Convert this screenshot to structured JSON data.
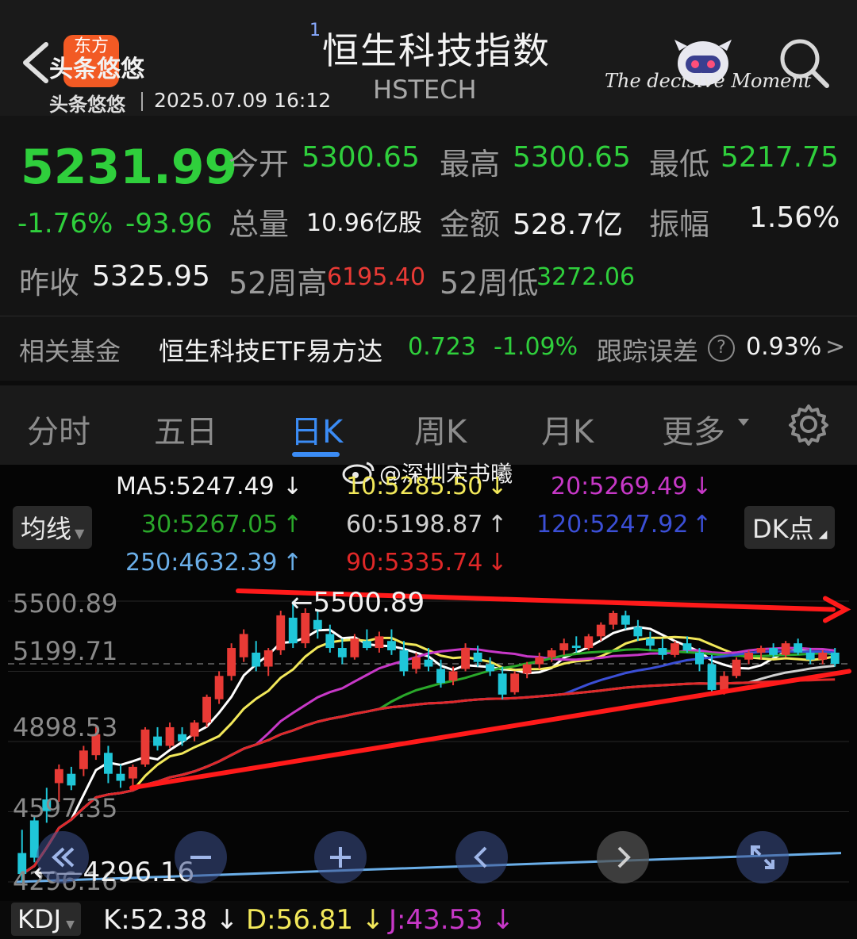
{
  "header": {
    "avatar_text": "东方",
    "author_name": "头条悠悠",
    "author_sub": "头条悠悠",
    "datetime": "2025.07.09 16:12",
    "title_badge": "1",
    "title": "恒生科技指数",
    "code": "HSTECH",
    "signature": "The decisive Moment"
  },
  "quote": {
    "price": "5231.99",
    "change_pct": "-1.76%",
    "change_abs": "-93.96",
    "prev_close_label": "昨收",
    "prev_close": "5325.95",
    "open_label": "今开",
    "open": "5300.65",
    "high_label": "最高",
    "high": "5300.65",
    "low_label": "最低",
    "low": "5217.75",
    "volume_label": "总量",
    "volume": "10.96亿股",
    "amount_label": "金额",
    "amount": "528.7亿",
    "amplitude_label": "振幅",
    "amplitude": "1.56%",
    "w52_high_label": "52周高",
    "w52_high": "6195.40",
    "w52_low_label": "52周低",
    "w52_low": "3272.06"
  },
  "fund": {
    "label": "相关基金",
    "name": "恒生科技ETF易方达",
    "price": "0.723",
    "change": "-1.09%",
    "tracking_label": "跟踪误差",
    "tracking_value": "0.93%",
    "chevron": ">"
  },
  "tabs": [
    {
      "label": "分时"
    },
    {
      "label": "五日"
    },
    {
      "label": "日K"
    },
    {
      "label": "周K"
    },
    {
      "label": "月K"
    },
    {
      "label": "更多"
    }
  ],
  "watermark": "@深圳宋书曦",
  "indicators": {
    "ma_button": "均线",
    "dk_button": "DK点",
    "ma5": "MA5:5247.49",
    "ma10": "10:5285.50",
    "ma20": "20:5269.49",
    "ma30": "30:5267.05",
    "ma60": "60:5198.87",
    "ma120": "120:5247.92",
    "ma250": "250:4632.39",
    "ma90": "90:5335.74",
    "down_arrow": "↓",
    "up_arrow": "↑"
  },
  "axis": {
    "labels": [
      "5500.89",
      "5199.71",
      "4898.53",
      "4597.35",
      "4296.16"
    ],
    "high_marker": "5500.89",
    "low_marker": "4296.16"
  },
  "kdj": {
    "button": "KDJ",
    "k": "K:52.38",
    "d": "D:56.81",
    "j": "J:43.53"
  },
  "colors": {
    "up": "#e83a35",
    "down": "#2fcf3c",
    "accent": "#3b8cf5",
    "ma5": "#ffffff",
    "ma10": "#f2e85a",
    "ma20": "#c738c7",
    "ma30": "#2aa82a",
    "ma60": "#d0d0d0",
    "ma120": "#3b4fd6",
    "ma250": "#6aaee8",
    "ma90": "#e02828",
    "trendline": "#ff1a1a"
  },
  "chart_data": {
    "type": "candlestick",
    "ylim": [
      4296.16,
      5500.89
    ],
    "y_ticks": [
      5500.89,
      5199.71,
      4898.53,
      4597.35,
      4296.16
    ],
    "ohlc": [
      [
        4420,
        4520,
        4296,
        4330
      ],
      [
        4560,
        4580,
        4380,
        4400
      ],
      [
        4650,
        4700,
        4550,
        4600
      ],
      [
        4720,
        4800,
        4640,
        4780
      ],
      [
        4760,
        4790,
        4690,
        4710
      ],
      [
        4780,
        4880,
        4750,
        4860
      ],
      [
        4840,
        4960,
        4820,
        4930
      ],
      [
        4850,
        4880,
        4720,
        4760
      ],
      [
        4760,
        4800,
        4700,
        4730
      ],
      [
        4740,
        4800,
        4710,
        4790
      ],
      [
        4800,
        4960,
        4790,
        4950
      ],
      [
        4920,
        4960,
        4860,
        4880
      ],
      [
        4880,
        4980,
        4870,
        4960
      ],
      [
        4930,
        4960,
        4880,
        4900
      ],
      [
        4920,
        4990,
        4900,
        4980
      ],
      [
        4980,
        5100,
        4960,
        5090
      ],
      [
        5080,
        5200,
        5060,
        5180
      ],
      [
        5180,
        5320,
        5160,
        5300
      ],
      [
        5260,
        5380,
        5240,
        5360
      ],
      [
        5280,
        5330,
        5200,
        5220
      ],
      [
        5220,
        5300,
        5180,
        5290
      ],
      [
        5290,
        5460,
        5270,
        5440
      ],
      [
        5430,
        5500,
        5300,
        5320
      ],
      [
        5320,
        5470,
        5300,
        5450
      ],
      [
        5420,
        5460,
        5340,
        5380
      ],
      [
        5360,
        5400,
        5280,
        5300
      ],
      [
        5300,
        5340,
        5230,
        5260
      ],
      [
        5260,
        5360,
        5250,
        5340
      ],
      [
        5330,
        5380,
        5290,
        5300
      ],
      [
        5300,
        5370,
        5280,
        5350
      ],
      [
        5330,
        5380,
        5270,
        5290
      ],
      [
        5290,
        5330,
        5180,
        5200
      ],
      [
        5210,
        5280,
        5190,
        5260
      ],
      [
        5250,
        5300,
        5200,
        5220
      ],
      [
        5210,
        5250,
        5130,
        5150
      ],
      [
        5160,
        5220,
        5140,
        5200
      ],
      [
        5210,
        5320,
        5200,
        5300
      ],
      [
        5280,
        5310,
        5220,
        5240
      ],
      [
        5230,
        5260,
        5180,
        5200
      ],
      [
        5190,
        5220,
        5080,
        5100
      ],
      [
        5110,
        5200,
        5100,
        5190
      ],
      [
        5190,
        5240,
        5170,
        5230
      ],
      [
        5230,
        5280,
        5210,
        5260
      ],
      [
        5260,
        5300,
        5240,
        5290
      ],
      [
        5290,
        5340,
        5270,
        5320
      ],
      [
        5310,
        5350,
        5280,
        5300
      ],
      [
        5300,
        5360,
        5290,
        5350
      ],
      [
        5350,
        5410,
        5330,
        5400
      ],
      [
        5400,
        5460,
        5380,
        5450
      ],
      [
        5440,
        5460,
        5380,
        5400
      ],
      [
        5390,
        5420,
        5330,
        5350
      ],
      [
        5340,
        5370,
        5290,
        5310
      ],
      [
        5300,
        5340,
        5250,
        5270
      ],
      [
        5270,
        5330,
        5260,
        5320
      ],
      [
        5320,
        5350,
        5280,
        5290
      ],
      [
        5280,
        5300,
        5200,
        5230
      ],
      [
        5230,
        5270,
        5110,
        5120
      ],
      [
        5120,
        5200,
        5100,
        5180
      ],
      [
        5180,
        5260,
        5170,
        5250
      ],
      [
        5250,
        5290,
        5230,
        5280
      ],
      [
        5280,
        5310,
        5250,
        5300
      ],
      [
        5300,
        5320,
        5260,
        5270
      ],
      [
        5270,
        5330,
        5260,
        5320
      ],
      [
        5320,
        5340,
        5270,
        5280
      ],
      [
        5280,
        5300,
        5230,
        5250
      ],
      [
        5250,
        5290,
        5230,
        5280
      ],
      [
        5280,
        5300,
        5220,
        5232
      ]
    ]
  }
}
